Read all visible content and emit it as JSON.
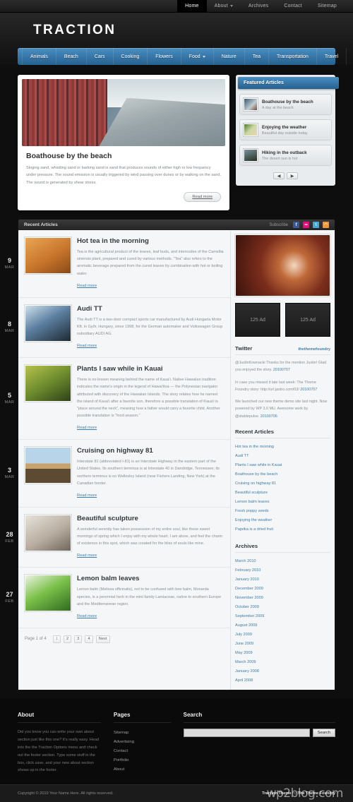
{
  "topnav": {
    "items": [
      {
        "label": "Home",
        "active": true,
        "caret": false
      },
      {
        "label": "About",
        "active": false,
        "caret": true
      },
      {
        "label": "Archives",
        "active": false,
        "caret": false
      },
      {
        "label": "Contact",
        "active": false,
        "caret": false
      },
      {
        "label": "Sitemap",
        "active": false,
        "caret": false
      }
    ]
  },
  "site": {
    "logo": "TRACTION"
  },
  "catnav": {
    "items": [
      {
        "label": "Animals",
        "caret": false
      },
      {
        "label": "Beach",
        "caret": false
      },
      {
        "label": "Cars",
        "caret": false
      },
      {
        "label": "Cooking",
        "caret": false
      },
      {
        "label": "Flowers",
        "caret": false
      },
      {
        "label": "Food",
        "caret": true
      },
      {
        "label": "Nature",
        "caret": false
      },
      {
        "label": "Tea",
        "caret": false
      },
      {
        "label": "Transportation",
        "caret": false
      },
      {
        "label": "Travel",
        "caret": false
      }
    ]
  },
  "featured": {
    "title": "Boathouse by the beach",
    "text": "Singing sand, whistling sand or barking sand is sand that produces sounds of either high or low frequency under pressure. The sound emission is usually triggered by wind passing over dunes or by walking on the sand. The sound is generated by shear stress.",
    "read_more": "Read more",
    "panel_title": "Featured Articles",
    "items": [
      {
        "title": "Boathouse by the beach",
        "sub": "A day at the beach"
      },
      {
        "title": "Enjoying the weather",
        "sub": "Beautiful day outside today"
      },
      {
        "title": "Hiking in the outback",
        "sub": "The desert sun is hot"
      }
    ],
    "prev_arrow": "◀",
    "next_arrow": "▶"
  },
  "contentbar": {
    "left_title": "Recent Articles",
    "subscribe_label": "Subscribe",
    "social": [
      {
        "name": "facebook-icon",
        "glyph": "f"
      },
      {
        "name": "flickr-icon",
        "glyph": "••"
      },
      {
        "name": "twitter-icon",
        "glyph": "t"
      },
      {
        "name": "rss-icon",
        "glyph": "◠"
      }
    ]
  },
  "articles": [
    {
      "day": "9",
      "month": "MAR",
      "title": "Hot tea in the morning",
      "text": "Tea is the agricultural product of the leaves, leaf buds, and internodes of the Camellia sinensis plant, prepared and cured by various methods. \"Tea\" also refers to the aromatic beverage prepared from the cured leaves by combination with hot or boiling water.",
      "read_more": "Read more",
      "thumb": "th-tea"
    },
    {
      "day": "8",
      "month": "MAR",
      "title": "Audi TT",
      "text": "The Audi TT is a two-door compact sports car manufactured by Audi Hungaria Motor Kft. in Győr, Hungary, since 1998, for the German automaker and Volkswagen Group subsidiary AUDI AG.",
      "read_more": "Read more",
      "thumb": "th-car"
    },
    {
      "day": "5",
      "month": "MAR",
      "title": "Plants I saw while in Kauai",
      "text": "There is no known meaning behind the name of Kaua'i. Native Hawaiian tradition indicates the name's origin in the legend of Hawai'iloa — the Polynesian navigator attributed with discovery of the Hawaiian Islands. The story relates how he named the island of Kaua'i after a favorite son, therefore a possible translation of Kaua'i is \"place around the neck\", meaning how a father would carry a favorite child. Another possible translation is \"food season.\"",
      "read_more": "Read more",
      "thumb": "th-plant"
    },
    {
      "day": "3",
      "month": "MAR",
      "title": "Cruising on highway 81",
      "text": "Interstate 81 (abbreviated I-81) is an Interstate Highway in the eastern part of the United States. Its southern terminus is at Interstate 40 in Dandridge, Tennessee; its northern terminus is on Wellesley Island (near Fishers Landing, New York) at the Canadian border.",
      "read_more": "Read more",
      "thumb": "th-road"
    },
    {
      "day": "28",
      "month": "FEB",
      "title": "Beautiful sculpture",
      "text": "A wonderful serenity has taken possession of my entire soul, like these sweet mornings of spring which I enjoy with my whole heart. I am alone, and feel the charm of existence in this spot, which was created for the bliss of souls like mine.",
      "read_more": "Read more",
      "thumb": "th-sculpt"
    },
    {
      "day": "27",
      "month": "FEB",
      "title": "Lemon balm leaves",
      "text": "Lemon balm (Melissa officinalis), not to be confused with bee balm, Monarda species, is a perennial herb in the mint family Lamiaceae, native to southern Europe and the Mediterranean region.",
      "read_more": "Read more",
      "thumb": "th-lemon"
    }
  ],
  "pagination": {
    "label": "Page 1 of 4",
    "pages": [
      "1",
      "2",
      "3",
      "4"
    ],
    "current": "1",
    "next_label": "Next"
  },
  "sidebar": {
    "ads": [
      {
        "label": "125 Ad"
      },
      {
        "label": "125 Ad"
      }
    ],
    "twitter": {
      "title": "Twitter",
      "handle": "thethemefoundry",
      "tweets": [
        {
          "text": "@JustinKownacki Thanks for the mention Justin! Glad you enjoyed the story.",
          "date": "20100707"
        },
        {
          "text": "In case you missed it late last week: The Theme Foundry story: http://url.jastro.com/03/",
          "date": "20100707"
        },
        {
          "text": "We launched our new theme demo site last night. Now powered by WP 3.0 MU. Awesome work by @stablepulse.",
          "date": "20100706"
        }
      ]
    },
    "recent": {
      "title": "Recent Articles",
      "items": [
        "Hot tea in the morning",
        "Audi TT",
        "Plants I saw while in Kauai",
        "Boathouse by the beach",
        "Cruising on highway 81",
        "Beautiful sculpture",
        "Lemon balm leaves",
        "Fresh poppy seeds",
        "Enjoying the weather",
        "Paprika is a dried fruit"
      ]
    },
    "archives": {
      "title": "Archives",
      "items": [
        "March 2010",
        "February 2010",
        "January 2010",
        "December 2009",
        "November 2009",
        "October 2009",
        "September 2009",
        "August 2009",
        "July 2009",
        "June 2009",
        "May 2009",
        "March 2009",
        "January 2008",
        "April 2008"
      ]
    }
  },
  "footer": {
    "about": {
      "title": "About",
      "text": "Did you know you can write your own about section just like this one? It's really easy. Head into the the Traction Options menu and check out the footer section. Type some stuff in the box, click save, and your new about section shows up in the footer."
    },
    "pages": {
      "title": "Pages",
      "items": [
        "Sitemap",
        "Advertising",
        "Contact",
        "Portfolio",
        "About"
      ]
    },
    "search": {
      "title": "Search",
      "value": "",
      "placeholder": "",
      "button": "Search"
    },
    "copyright": "Copyright © 2010 Your Name Here. All rights reserved.",
    "credit_prefix": "Traction Theme",
    "credit_mid": "by",
    "credit_suffix": "The Theme Foundry",
    "watermark": "wp2blog.com"
  }
}
